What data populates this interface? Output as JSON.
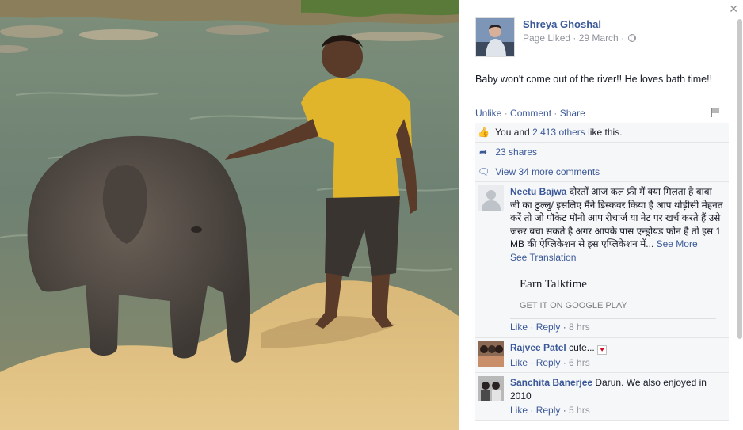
{
  "post": {
    "page_name": "Shreya Ghoshal",
    "meta": "Page Liked · 29 March ·",
    "caption": "Baby won't come out of the river!! He loves bath time!!"
  },
  "actions": {
    "unlike": "Unlike",
    "comment": "Comment",
    "share": "Share",
    "separator": "·"
  },
  "feed": {
    "likes_prefix": "You and",
    "likes_link": "2,413 others",
    "likes_suffix": "like this.",
    "shares": "23 shares",
    "view_more": "View 34 more comments"
  },
  "comments": [
    {
      "name": "Neetu Bajwa",
      "text": "दोस्तों आज कल फ्री में क्या मिलता है बाबा जी का ठुल्लु/ इसलिए मैंने डिस्कवर किया है आप थोड़ीसी मेहनत करें तो जो पॉकेट मॉनी आप रीचार्ज या नेट पर खर्च करते हैं उसे जरुर बचा सकते है अगर आपके पास एन्ड्रोयड फोन है तो इस 1 MB की ऐप्लिकेशन से इस एप्लिकेशन में...",
      "see_more": "See More",
      "see_translation": "See Translation",
      "card_title": "Earn Talktime",
      "card_sub": "GET IT ON GOOGLE PLAY",
      "like": "Like",
      "reply": "Reply",
      "time": "8 hrs"
    },
    {
      "name": "Rajvee Patel",
      "text": "cute...",
      "like": "Like",
      "reply": "Reply",
      "time": "6 hrs"
    },
    {
      "name": "Sanchita Banerjee",
      "text": "Darun. We also enjoyed in 2010",
      "like": "Like",
      "reply": "Reply",
      "time": "5 hrs"
    }
  ],
  "icons": {
    "close": "close-icon",
    "globe": "globe-icon",
    "flag": "flag-icon",
    "like": "thumbs-up-icon",
    "share": "share-arrow-icon",
    "comment": "speech-bubble-icon",
    "heart": "heart-icon"
  },
  "colors": {
    "link": "#3b5998",
    "muted": "#90949c",
    "feed_bg": "#f6f7f9"
  }
}
